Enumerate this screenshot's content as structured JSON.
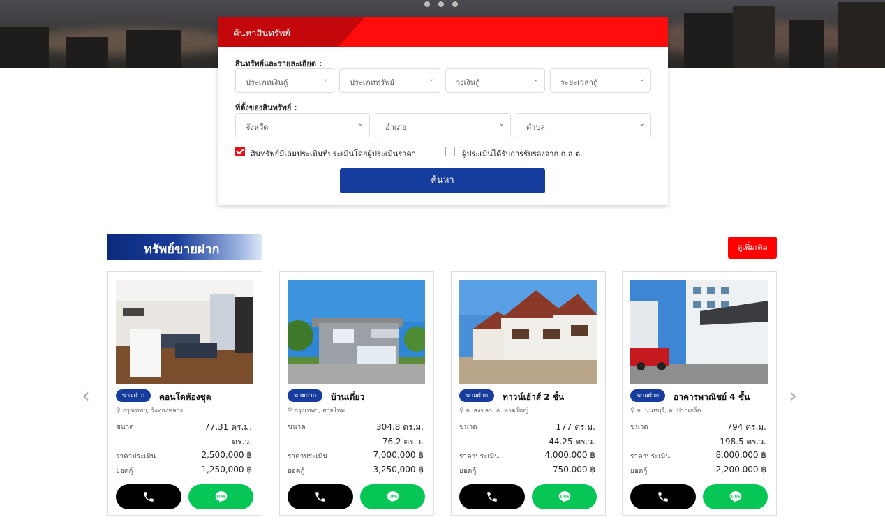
{
  "search": {
    "title": "ค้นหาสินทรัพย์",
    "section_details": "สินทรัพย์และรายละเอียด :",
    "section_location": "ที่ตั้งของสินทรัพย์ :",
    "filters": {
      "loan_type": "ประเภทเงินกู้",
      "property_type": "ประเภททรัพย์",
      "loan_amount": "วงเงินกู้",
      "loan_term": "ระยะเวลากู้",
      "province": "จังหวัด",
      "district": "อำเภอ",
      "subdistrict": "ตำบล"
    },
    "checkbox_appraised": {
      "label": "สินทรัพย์มีเล่มประเมินที่ประเมินโดยผู้ประเมินราคา",
      "checked": true
    },
    "checkbox_sec": {
      "label": "ผู้ประเมินได้รับการรับรองจาก ก.ล.ต.",
      "checked": false
    },
    "button": "ค้นหา"
  },
  "listing": {
    "title": "ทรัพย์ขายฝาก",
    "more_button": "ดูเพิ่มเติม",
    "labels": {
      "size": "ขนาด",
      "appraisal": "ราคาประเมิน",
      "loan": "ยอดกู้"
    },
    "cards": [
      {
        "badge": "ขายฝาก",
        "type": "คอนโดห้องชุด",
        "location": "กรุงเทพฯ, วังทองหลาง",
        "size1": "77.31 ตร.ม.",
        "size2": "- ตร.ว.",
        "appraisal": "2,500,000 ฿",
        "loan": "1,250,000 ฿"
      },
      {
        "badge": "ขายฝาก",
        "type": "บ้านเดี่ยว",
        "location": "กรุงเทพฯ, สายไหม",
        "size1": "304.8 ตร.ม.",
        "size2": "76.2 ตร.ว.",
        "appraisal": "7,000,000 ฿",
        "loan": "3,250,000 ฿"
      },
      {
        "badge": "ขายฝาก",
        "type": "ทาวน์เฮ้าส์ 2 ชั้น",
        "location": "จ. สงขลา, อ. หาดใหญ่",
        "size1": "177 ตร.ม.",
        "size2": "44.25 ตร.ว.",
        "appraisal": "4,000,000 ฿",
        "loan": "750,000 ฿"
      },
      {
        "badge": "ขายฝาก",
        "type": "อาคารพาณิชย์ 4 ชั้น",
        "location": "จ. นนทบุรี, อ. ปากเกร็ด",
        "size1": "794 ตร.ม.",
        "size2": "198.5 ตร.ว.",
        "appraisal": "8,000,000 ฿",
        "loan": "2,200,000 ฿"
      }
    ]
  },
  "icons": {
    "call": "phone-icon",
    "line": "line-icon",
    "location": "map-pin-icon",
    "prev": "chevron-left-icon",
    "next": "chevron-right-icon"
  },
  "colors": {
    "brand_red": "#ff0d0d",
    "brand_blue": "#163c9e",
    "line_green": "#06c755"
  }
}
